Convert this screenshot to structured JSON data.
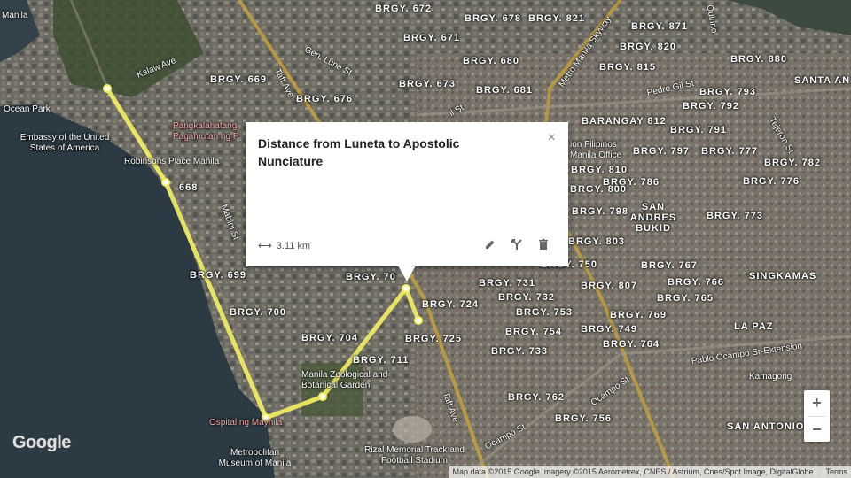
{
  "popup": {
    "title": "Distance from Luneta to Apostolic Nunciature",
    "distance": "3.11 km",
    "close_label": "×"
  },
  "zoom": {
    "in": "+",
    "out": "−"
  },
  "brand": "Google",
  "attribution": {
    "text": "Map data ©2015 Google Imagery ©2015 Aerometrex, CNES / Astrium, Cnes/Spot Image, DigitalGlobe",
    "terms": "Terms"
  },
  "colors": {
    "route": "#f4ef63",
    "water": "#2b3a43",
    "land": "#6a6a62",
    "popup_bg": "#ffffff"
  },
  "places": {
    "manila": "Manila",
    "ocean_park": "Ocean Park",
    "embassy": "Embassy of the United States of America",
    "robinsons": "Robinsons Place Manila",
    "pangkalahatang": "Pangkalahatang Pagamutan ng P",
    "ospital": "Ospital ng Maynila",
    "metropolitan": "Metropolitan Museum of Manila",
    "manila_garden": "Manila Zoological and Botanical Garden",
    "rizal": "Rizal Memorial Track and Football Stadium",
    "philippines": "ion Filipinos Manila Office",
    "san_andres": "SAN ANDRES BUKID",
    "singkamas": "SINGKAMAS",
    "la_paz": "LA PAZ",
    "santa_ana": "SANTA AN",
    "kamagong": "Kamagong",
    "san_antonio": "SAN ANTONIO",
    "barangay_812": "BARANGAY 812"
  },
  "streets": {
    "kalaw": "Kalaw Ave",
    "taft": "Taft Ave",
    "gen_luna": "Gen. Luna St",
    "skyway": "Metro Manila Skyway",
    "pedro_gil": "Pedro Gil St",
    "pablo_ocampo": "Pablo Ocampo Sr-Extension",
    "ocampo_st": "Ocampo St",
    "ocampo_st2": "Ocampo St",
    "tejeron": "Tejeron St",
    "quirino": "Quirino",
    "mabini": "Mabini St",
    "taft2": "Taft Ave",
    "ilt": "il St"
  },
  "barangays": [
    "BRGY. 672",
    "BRGY. 678",
    "BRGY. 821",
    "BRGY. 871",
    "BRGY. 671",
    "BRGY. 820",
    "BRGY. 880",
    "BRGY. 680",
    "BRGY. 815",
    "BRGY. 673",
    "BRGY. 681",
    "BRGY. 793",
    "BRGY. 792",
    "BRGY. 669",
    "BRGY. 676",
    "BRGY. 791",
    "BRGY. 797",
    "BRGY. 777",
    "BRGY. 810",
    "BRGY. 786",
    "BRGY. 782",
    "BRGY. 776",
    "BRGY. 800",
    "BRGY. 798",
    "BRGY. 773",
    "BRGY. 803",
    "BRGY. 750",
    "BRGY. 767",
    "BRGY. 766",
    "BRGY. 731",
    "BRGY. 807",
    "BRGY. 765",
    "BRGY. 732",
    "BRGY. 753",
    "BRGY. 724",
    "BRGY. 769",
    "BRGY. 725",
    "BRGY. 754",
    "BRGY. 749",
    "BRGY. 733",
    "BRGY. 764",
    "BRGY. 762",
    "BRGY. 756",
    "BRGY. 699",
    "BRGY. 700",
    "BRGY. 704",
    "BRGY. 711",
    "BRGY. 70",
    "668"
  ]
}
